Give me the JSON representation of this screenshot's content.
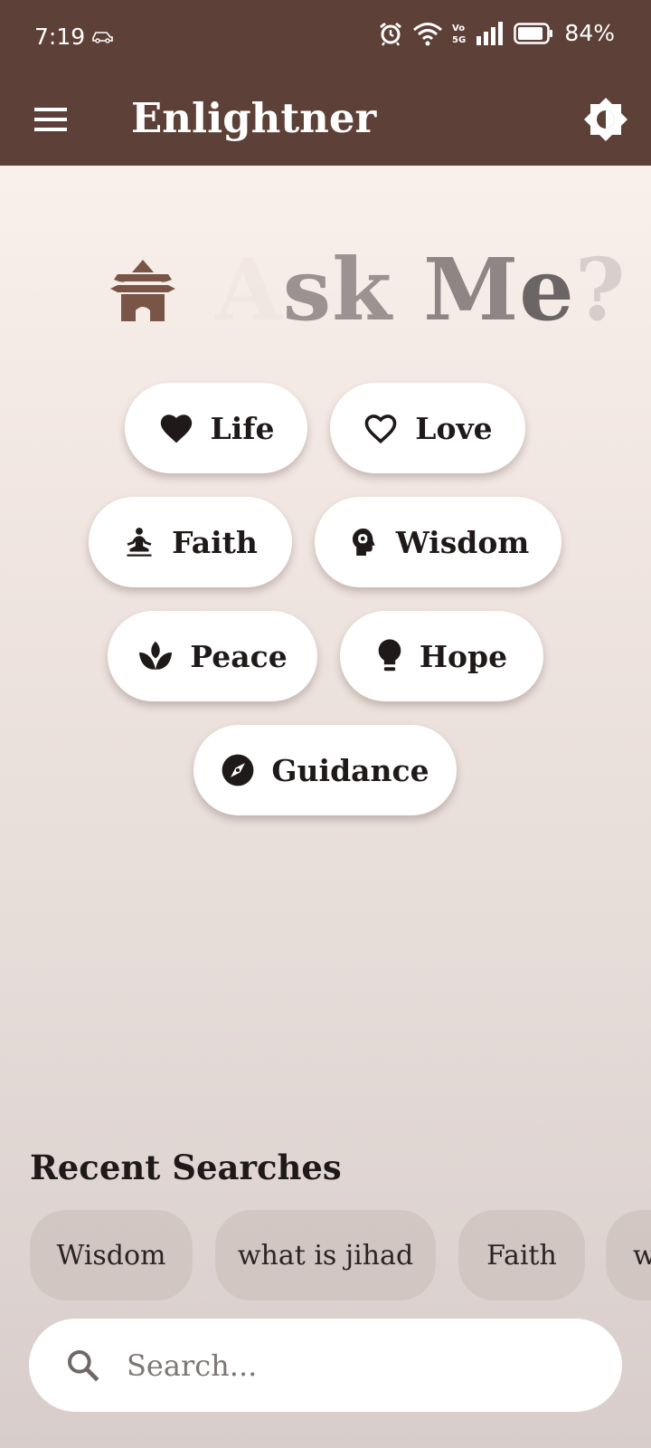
{
  "status_bar": {
    "time": "7:19",
    "battery_percent": "84%",
    "icons": [
      "car-icon",
      "alarm-icon",
      "wifi-icon",
      "volte-5g-icon",
      "signal-icon",
      "battery-icon"
    ]
  },
  "app_bar": {
    "title": "Enlightner",
    "menu_icon": "hamburger-menu-icon",
    "theme_icon": "brightness-icon",
    "color": "#5d4037"
  },
  "hero": {
    "icon": "temple-icon",
    "letters": [
      "A",
      "sk ",
      "M",
      "e",
      "?"
    ],
    "icon_color": "#795548"
  },
  "topics": [
    {
      "label": "Life",
      "icon": "heart-filled-icon"
    },
    {
      "label": "Love",
      "icon": "heart-outline-icon"
    },
    {
      "label": "Faith",
      "icon": "meditation-icon"
    },
    {
      "label": "Wisdom",
      "icon": "head-gear-icon"
    },
    {
      "label": "Peace",
      "icon": "lotus-icon"
    },
    {
      "label": "Hope",
      "icon": "lightbulb-icon"
    },
    {
      "label": "Guidance",
      "icon": "compass-icon"
    }
  ],
  "recent": {
    "title": "Recent Searches",
    "items": [
      "Wisdom",
      "what is jihad",
      "Faith",
      "w"
    ]
  },
  "search": {
    "placeholder": "Search...",
    "value": "",
    "icon": "search-icon"
  }
}
